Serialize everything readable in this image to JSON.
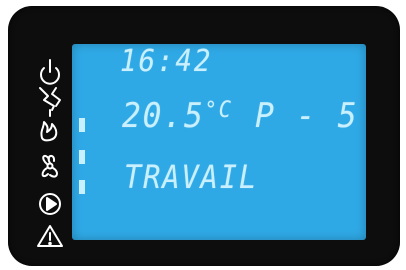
{
  "display": {
    "time": "16:42",
    "temperature": "20.5",
    "temperature_unit": "°C",
    "program": "P - 5",
    "mode": "TRAVAIL"
  },
  "icons": [
    "power-standby-icon",
    "energy-lightning-icon",
    "flame-burner-icon",
    "fan-icon",
    "play-circle-icon",
    "warning-triangle-icon"
  ],
  "level_indicator": {
    "segments_lit": 3
  },
  "colors": {
    "bezel": "#0d0d0d",
    "lcd_background": "#2fa9e6",
    "lcd_segments": "#c9f0ff",
    "icon_color": "#ffffff"
  }
}
